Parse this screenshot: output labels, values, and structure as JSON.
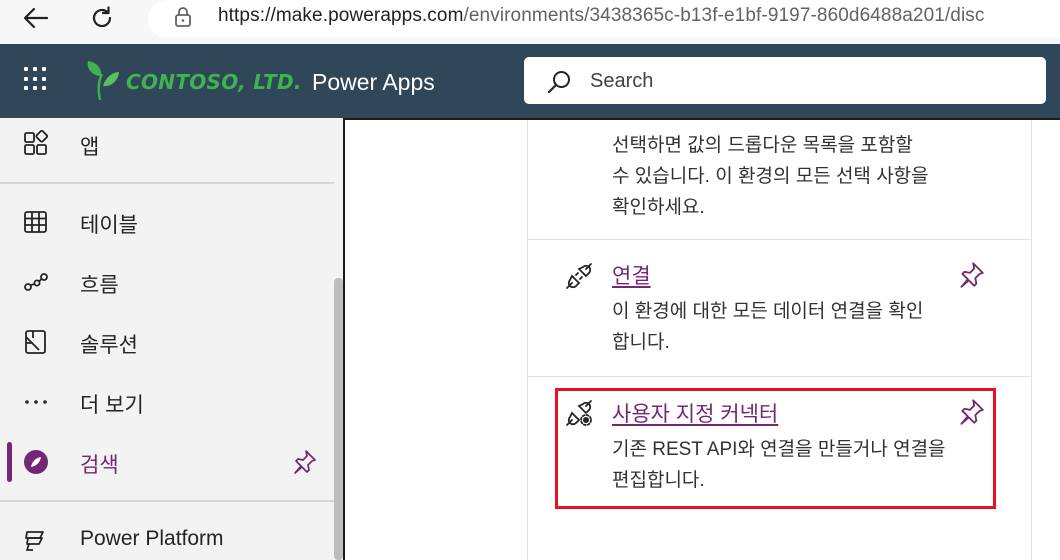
{
  "browser": {
    "url_host": "https://make.powerapps.com",
    "url_path": "/environments/3438365c-b13f-e1bf-9197-860d6488a201/disc"
  },
  "header": {
    "brand": "CONTOSO, LTD.",
    "app_name": "Power Apps",
    "search_placeholder": "Search"
  },
  "sidebar": {
    "items": [
      {
        "label": "앱",
        "icon": "apps-icon"
      },
      {
        "label": "테이블",
        "icon": "table-icon"
      },
      {
        "label": "흐름",
        "icon": "flow-icon"
      },
      {
        "label": "솔루션",
        "icon": "solution-icon"
      },
      {
        "label": "더 보기",
        "icon": "more-icon"
      },
      {
        "label": "검색",
        "icon": "discover-icon",
        "active": true
      },
      {
        "label": "Power Platform",
        "icon": "power-platform-icon"
      }
    ]
  },
  "cards": [
    {
      "title": "",
      "desc_lines": [
        "선택하면 값의 드롭다운 목록을 포함할",
        "수 있습니다. 이 환경의 모든 선택 사항을",
        "확인하세요."
      ]
    },
    {
      "title": "연결",
      "icon": "connection-icon",
      "desc_lines": [
        "이 환경에 대한 모든 데이터 연결을 확인",
        "합니다."
      ]
    },
    {
      "title": "사용자 지정 커넥터",
      "icon": "custom-connector-icon",
      "desc_lines": [
        "기존 REST API와 연결을 만들거나 연결을",
        "편집합니다."
      ],
      "highlighted": true
    }
  ],
  "colors": {
    "header_bg": "#2f4759",
    "accent": "#742774",
    "highlight": "#e81123",
    "brand": "#3fb34f"
  }
}
